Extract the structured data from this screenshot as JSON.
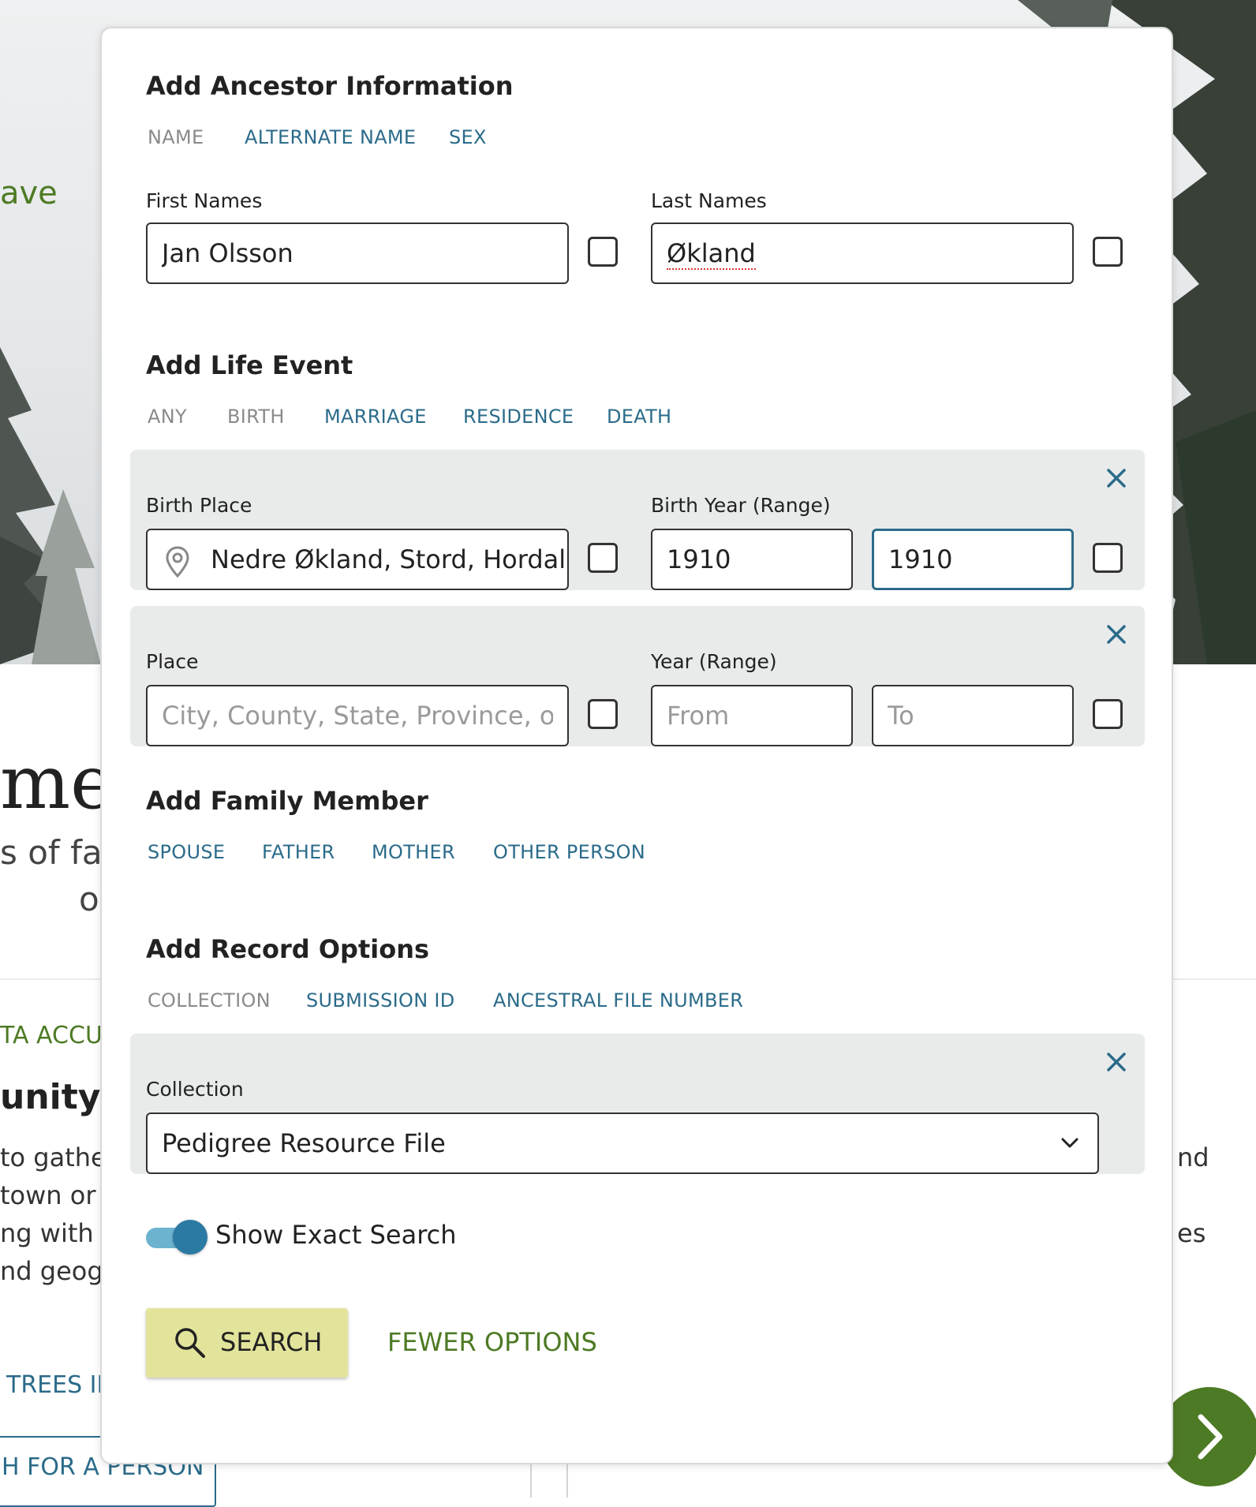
{
  "background": {
    "fragment_ave": "ave",
    "fragment_me": "me",
    "fragment_sub": "s of far",
    "fragment_o": "o",
    "fragment_accuracy": "TA ACCUF",
    "fragment_unity": "unity T",
    "paragraph_lines": [
      "to gathe",
      "town or",
      "ng with t",
      "nd geogr"
    ],
    "right_lines": [
      "nd",
      "es"
    ],
    "trees_link": "TREES IN",
    "search_person_button": "H FOR A PERSON"
  },
  "dialog": {
    "ancestor": {
      "title": "Add Ancestor Information",
      "tabs": [
        {
          "label": "NAME",
          "active": false
        },
        {
          "label": "ALTERNATE NAME",
          "active": true
        },
        {
          "label": "SEX",
          "active": true
        }
      ],
      "first_names_label": "First Names",
      "first_names_value": "Jan Olsson",
      "last_names_label": "Last Names",
      "last_names_value": "Økland"
    },
    "life_event": {
      "title": "Add Life Event",
      "tabs": [
        {
          "label": "ANY",
          "active": false
        },
        {
          "label": "BIRTH",
          "active": false
        },
        {
          "label": "MARRIAGE",
          "active": true
        },
        {
          "label": "RESIDENCE",
          "active": true
        },
        {
          "label": "DEATH",
          "active": true
        }
      ],
      "birth": {
        "place_label": "Birth Place",
        "place_value": "Nedre Økland, Stord, Hordaland",
        "year_label": "Birth Year (Range)",
        "year_from": "1910",
        "year_to": "1910"
      },
      "any": {
        "place_label": "Place",
        "place_placeholder": "City, County, State, Province, or Country",
        "year_label": "Year (Range)",
        "from_placeholder": "From",
        "to_placeholder": "To"
      }
    },
    "family": {
      "title": "Add Family Member",
      "tabs": [
        {
          "label": "SPOUSE",
          "active": true
        },
        {
          "label": "FATHER",
          "active": true
        },
        {
          "label": "MOTHER",
          "active": true
        },
        {
          "label": "OTHER PERSON",
          "active": true
        }
      ]
    },
    "record_options": {
      "title": "Add Record Options",
      "tabs": [
        {
          "label": "COLLECTION",
          "active": false
        },
        {
          "label": "SUBMISSION ID",
          "active": true
        },
        {
          "label": "ANCESTRAL FILE NUMBER",
          "active": true
        }
      ],
      "collection_label": "Collection",
      "collection_value": "Pedigree Resource File"
    },
    "exact_search": {
      "label": "Show Exact Search",
      "on": true
    },
    "search_button": "SEARCH",
    "fewer_options": "FEWER OPTIONS"
  },
  "colors": {
    "link_blue": "#2b6b8a",
    "green": "#4d7a24",
    "search_yellow": "#e3e49c",
    "toggle_blue": "#2b7aa3"
  }
}
